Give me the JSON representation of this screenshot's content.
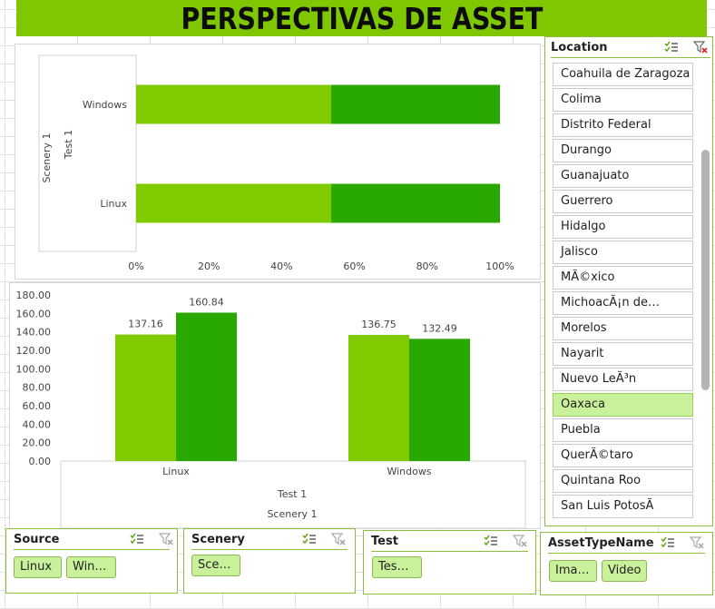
{
  "title": "PERSPECTIVAS DE ASSET",
  "colors": {
    "title_bg": "#7fc700",
    "light_green": "#7fcb00",
    "dark_green": "#29a800",
    "selected_item": "#c9f09a"
  },
  "chart_data": [
    {
      "type": "bar",
      "orientation": "horizontal",
      "stacked": "100%",
      "categories": [
        "Windows",
        "Linux"
      ],
      "series": [
        {
          "values": [
            53.6,
            53.6
          ],
          "color": "#7fcb00"
        },
        {
          "values": [
            46.4,
            46.4
          ],
          "color": "#29a800"
        }
      ],
      "x_ticks": [
        "0%",
        "20%",
        "40%",
        "60%",
        "80%",
        "100%"
      ],
      "ylabels": [
        "Scenery 1",
        "Test 1"
      ],
      "xlim": [
        0,
        100
      ]
    },
    {
      "type": "bar",
      "categories": [
        "Linux",
        "Windows"
      ],
      "series": [
        {
          "values": [
            137.16,
            136.75
          ],
          "color": "#7fcb00"
        },
        {
          "values": [
            160.84,
            132.49
          ],
          "color": "#29a800"
        }
      ],
      "data_labels": [
        [
          "137.16",
          "136.75"
        ],
        [
          "160.84",
          "132.49"
        ]
      ],
      "y_ticks": [
        "180.00",
        "160.00",
        "140.00",
        "120.00",
        "100.00",
        "80.00",
        "60.00",
        "40.00",
        "20.00",
        "0.00"
      ],
      "xlabels": [
        "Test 1",
        "Scenery 1"
      ],
      "ylim": [
        0,
        180
      ]
    }
  ],
  "location": {
    "title": "Location",
    "items": [
      "Coahuila de Zaragoza",
      "Colima",
      "Distrito Federal",
      "Durango",
      "Guanajuato",
      "Guerrero",
      "Hidalgo",
      "Jalisco",
      "MÃ©xico",
      "MichoacÃ¡n de…",
      "Morelos",
      "Nayarit",
      "Nuevo LeÃ³n",
      "Oaxaca",
      "Puebla",
      "QuerÃ©taro",
      "Quintana Roo",
      "San Luis PotosÃ"
    ],
    "selected": "Oaxaca"
  },
  "source": {
    "title": "Source",
    "items": [
      "Linux",
      "Win…"
    ]
  },
  "scenery": {
    "title": "Scenery",
    "items": [
      "Sce…"
    ]
  },
  "test": {
    "title": "Test",
    "items": [
      "Tes…"
    ]
  },
  "asset_type": {
    "title": "AssetTypeName",
    "items": [
      "Ima…",
      "Video"
    ]
  },
  "icons": {
    "multi_select": "multi-select-icon",
    "clear_filter": "clear-filter-icon"
  }
}
